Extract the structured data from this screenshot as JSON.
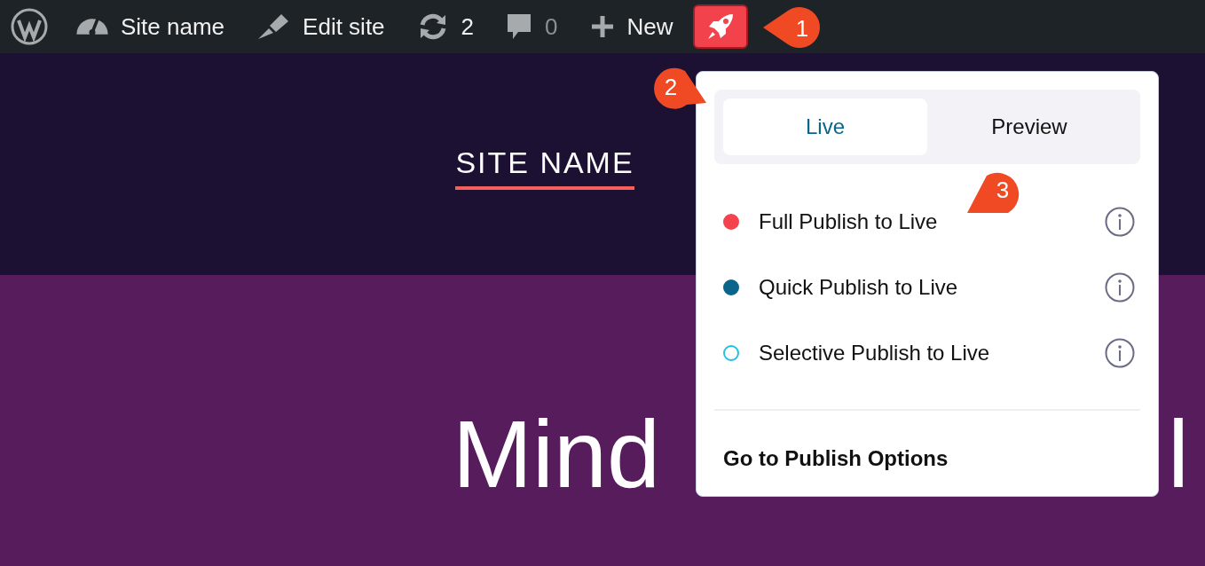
{
  "admin_bar": {
    "site_name": "Site name",
    "edit_site": "Edit site",
    "updates": "2",
    "comments": "0",
    "new": "New"
  },
  "site_header": {
    "title": "SITE NAME"
  },
  "hero": {
    "heading": "Mind",
    "heading_tail": "l"
  },
  "publish_menu": {
    "tabs": [
      {
        "label": "Live",
        "selected": true
      },
      {
        "label": "Preview",
        "selected": false
      }
    ],
    "options": [
      {
        "label": "Full Publish to Live",
        "color": "#f4434f",
        "hollow": false
      },
      {
        "label": "Quick Publish to Live",
        "color": "#0b6489",
        "hollow": false
      },
      {
        "label": "Selective Publish to Live",
        "color": "#22c3dd",
        "hollow": true
      }
    ],
    "footer_link": "Go to Publish Options"
  },
  "callouts": [
    {
      "number": "1",
      "kind": "left"
    },
    {
      "number": "2",
      "kind": "right"
    },
    {
      "number": "3",
      "kind": "below"
    }
  ]
}
